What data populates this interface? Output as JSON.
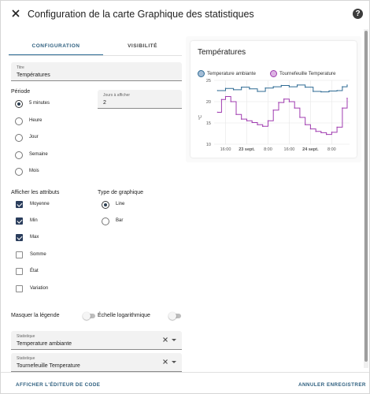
{
  "header": {
    "title": "Configuration de la carte Graphique des statistiques",
    "close_icon": "close-icon",
    "help_icon": "help-icon"
  },
  "tabs": [
    {
      "label": "CONFIGURATION",
      "active": true
    },
    {
      "label": "VISIBILITÉ",
      "active": false
    }
  ],
  "form": {
    "title_field": {
      "label": "Titre",
      "value": "Températures"
    },
    "period": {
      "label": "Période",
      "options": [
        {
          "label": "5 minutes",
          "selected": true
        },
        {
          "label": "Heure",
          "selected": false
        },
        {
          "label": "Jour",
          "selected": false
        },
        {
          "label": "Semaine",
          "selected": false
        },
        {
          "label": "Mois",
          "selected": false
        }
      ]
    },
    "days_field": {
      "label": "Jours à afficher",
      "value": "2"
    },
    "attributes": {
      "label": "Afficher les attributs",
      "options": [
        {
          "label": "Moyenne",
          "checked": true
        },
        {
          "label": "Min",
          "checked": true
        },
        {
          "label": "Max",
          "checked": true
        },
        {
          "label": "Somme",
          "checked": false
        },
        {
          "label": "État",
          "checked": false
        },
        {
          "label": "Variation",
          "checked": false
        }
      ]
    },
    "chart_type": {
      "label": "Type de graphique",
      "options": [
        {
          "label": "Line",
          "selected": true
        },
        {
          "label": "Bar",
          "selected": false
        }
      ]
    },
    "hide_legend": {
      "label": "Masquer la légende",
      "on": false
    },
    "log_scale": {
      "label": "Échelle logarithmique",
      "on": false
    },
    "statistics": [
      {
        "label": "Statistique",
        "value": "Temperature ambiante"
      },
      {
        "label": "Statistique",
        "value": "Tournefeuille Temperature"
      }
    ]
  },
  "footer": {
    "code_editor_label": "AFFICHER L'ÉDITEUR DE CODE",
    "cancel_label": "ANNULER",
    "save_label": "ENREGISTRER"
  },
  "preview": {
    "card_title": "Températures",
    "legend": [
      {
        "label": "Temperature ambiante",
        "color": "#2f6b94"
      },
      {
        "label": "Tournefeuille Temperature",
        "color": "#a03cb0"
      }
    ]
  },
  "colors": {
    "accent": "#2e5f7f",
    "series_1": "#2f6b94",
    "series_2": "#a03cb0"
  },
  "chart_data": {
    "type": "line",
    "title": "Températures",
    "ylabel": "°C",
    "ylim": [
      10,
      25
    ],
    "yticks": [
      "25",
      "20",
      "15",
      "10"
    ],
    "xticks": [
      {
        "label": "16:00",
        "bold": false,
        "x": 0
      },
      {
        "label": "23 sept.",
        "bold": true,
        "x": 8
      },
      {
        "label": "8:00",
        "bold": false,
        "x": 16
      },
      {
        "label": "16:00",
        "bold": false,
        "x": 24
      },
      {
        "label": "24 sept.",
        "bold": true,
        "x": 32
      },
      {
        "label": "8:00",
        "bold": false,
        "x": 40
      }
    ],
    "xlim": [
      -4.3,
      46.7
    ],
    "grid": true,
    "series": [
      {
        "name": "Temperature ambiante",
        "x": [
          -3.0,
          0.0,
          3.0,
          6.0,
          9.0,
          12.0,
          15.0,
          18.0,
          21.0,
          24.0,
          27.0,
          30.0,
          33.0,
          36.0,
          39.0,
          42.0,
          44.0,
          45.8
        ],
        "y": [
          22.6,
          23.1,
          22.8,
          23.4,
          23.0,
          22.4,
          23.2,
          23.5,
          23.8,
          23.5,
          23.9,
          23.4,
          22.4,
          22.3,
          22.5,
          22.6,
          23.5,
          23.9
        ]
      },
      {
        "name": "Tournefeuille Temperature",
        "x": [
          -3.0,
          -1.5,
          0.0,
          2.0,
          4.0,
          6.0,
          8.0,
          10.0,
          12.0,
          14.0,
          16.0,
          18.0,
          20.0,
          22.0,
          24.0,
          26.0,
          28.0,
          30.0,
          32.0,
          34.0,
          36.0,
          38.0,
          40.0,
          42.0,
          44.0,
          45.8
        ],
        "y": [
          17.5,
          20.5,
          21.2,
          20.0,
          17.0,
          15.9,
          15.5,
          15.1,
          14.6,
          14.2,
          15.5,
          18.0,
          19.8,
          20.6,
          20.0,
          18.5,
          16.3,
          14.6,
          13.6,
          13.0,
          12.7,
          12.3,
          12.8,
          14.0,
          18.5,
          20.8
        ]
      }
    ]
  }
}
